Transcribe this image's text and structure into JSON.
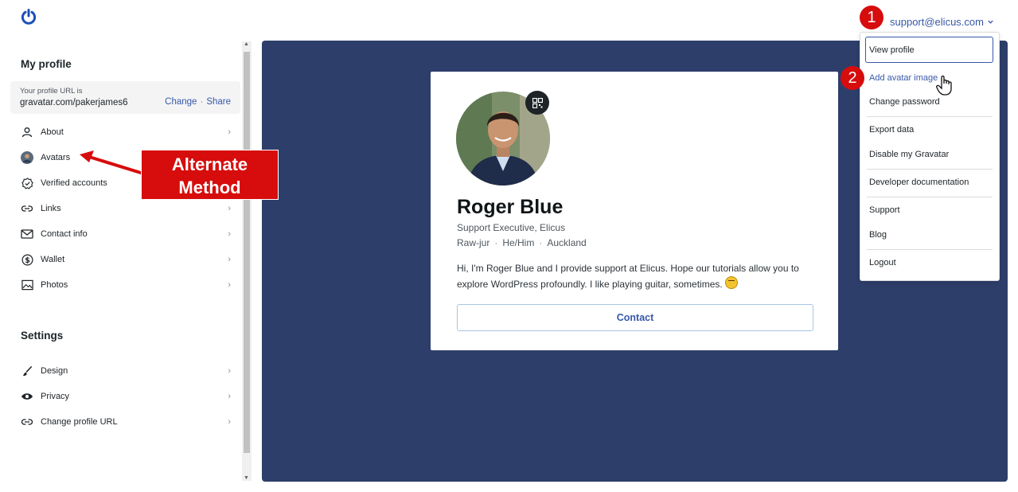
{
  "header": {
    "account_email": "support@elicus.com",
    "icons": [
      "power-logo-icon",
      "chevron-down-icon"
    ]
  },
  "sidebar": {
    "profile_heading": "My profile",
    "profile_url": {
      "caption": "Your profile URL is",
      "value": "gravatar.com/pakerjames6",
      "change_label": "Change",
      "separator": "·",
      "share_label": "Share"
    },
    "profile_items": [
      {
        "label": "About",
        "icon": "person-icon"
      },
      {
        "label": "Avatars",
        "icon": "avatar-thumbnail"
      },
      {
        "label": "Verified accounts",
        "icon": "verified-badge-icon"
      },
      {
        "label": "Links",
        "icon": "link-icon"
      },
      {
        "label": "Contact info",
        "icon": "mail-icon"
      },
      {
        "label": "Wallet",
        "icon": "dollar-icon"
      },
      {
        "label": "Photos",
        "icon": "image-icon"
      }
    ],
    "settings_heading": "Settings",
    "settings_items": [
      {
        "label": "Design",
        "icon": "brush-icon"
      },
      {
        "label": "Privacy",
        "icon": "eye-icon"
      },
      {
        "label": "Change profile URL",
        "icon": "link-icon"
      }
    ]
  },
  "profile_card": {
    "name": "Roger Blue",
    "job": "Support Executive, Elicus",
    "pronunciation": "Raw-jur",
    "pronouns": "He/Him",
    "location": "Auckland",
    "meta_separator": "·",
    "bio": "Hi, I'm Roger Blue and I provide support at Elicus. Hope our tutorials allow you to explore WordPress profoundly. I like playing guitar, sometimes.",
    "contact_label": "Contact"
  },
  "account_menu": {
    "items": [
      "View profile",
      "Add avatar image",
      "Change password",
      "Export data",
      "Disable my Gravatar",
      "Developer documentation",
      "Support",
      "Blog",
      "Logout"
    ]
  },
  "annotations": {
    "callout_line1": "Alternate",
    "callout_line2": "Method",
    "step1": "1",
    "step2": "2"
  },
  "colors": {
    "accent": "#3858a8",
    "preview_background": "#2d3e6b",
    "annotation_red": "#d70c0c"
  }
}
